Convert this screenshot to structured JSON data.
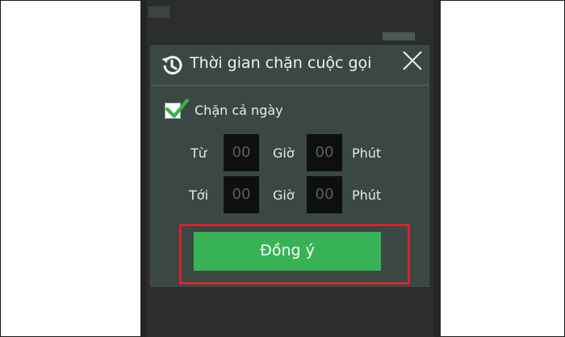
{
  "dialog": {
    "title": "Thời gian chặn cuộc gọi",
    "checkbox_label": "Chặn cả ngày",
    "checkbox_checked": true,
    "rows": [
      {
        "from_label": "Từ",
        "hour_value": "00",
        "hour_label": "Giờ",
        "minute_value": "00",
        "minute_label": "Phút"
      },
      {
        "from_label": "Tới",
        "hour_value": "00",
        "hour_label": "Giờ",
        "minute_value": "00",
        "minute_label": "Phút"
      }
    ],
    "confirm_label": "Đồng ý"
  },
  "colors": {
    "dialog_bg": "#3a4743",
    "confirm_green": "#37b356",
    "highlight_red": "#d8242b",
    "check_green": "#3fae4b"
  },
  "icons": {
    "header": "history-icon",
    "close": "close-icon",
    "check": "check-icon"
  }
}
